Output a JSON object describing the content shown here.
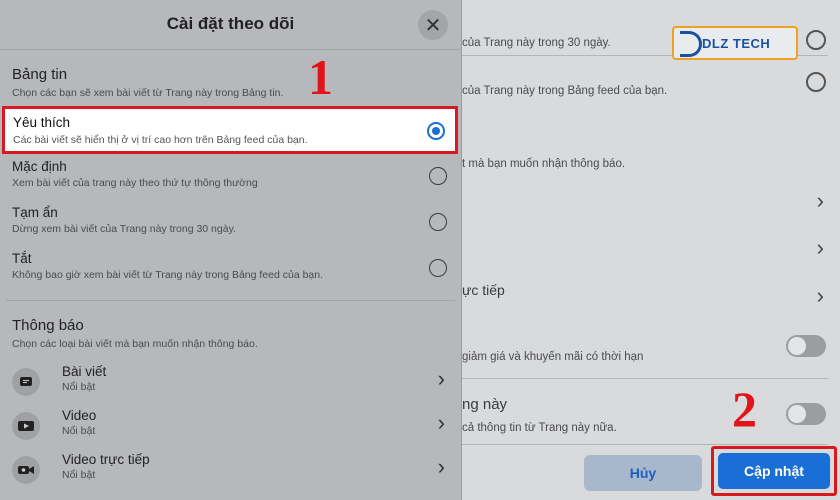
{
  "background": {
    "rows": [
      {
        "text": "của Trang này trong 30 ngày."
      },
      {
        "text": "của Trang này trong Bảng feed của bạn."
      },
      {
        "text": "t mà bạn muốn nhận thông báo."
      },
      {
        "text": "ực tiếp"
      },
      {
        "text": "giảm giá và khuyến mãi có thời hạn"
      },
      {
        "text": "ng này"
      },
      {
        "text": "cả thông tin từ Trang này nữa."
      }
    ],
    "logo_text": "DLZ TECH",
    "cancel_label": "Hủy",
    "update_label": "Cập nhật"
  },
  "dialog": {
    "title": "Cài đặt theo dõi",
    "close_glyph": "✕",
    "feed": {
      "title": "Bảng tin",
      "subtitle": "Chọn các bạn sẽ xem bài viết từ Trang này trong Bảng tin.",
      "options": [
        {
          "label": "Yêu thích",
          "desc": "Các bài viết sẽ hiển thị ở vị trí cao hơn trên Bảng feed của bạn.",
          "selected": true
        },
        {
          "label": "Mặc định",
          "desc": "Xem bài viết của trang này theo thứ tự thông thường",
          "selected": false
        },
        {
          "label": "Tạm ẩn",
          "desc": "Dừng xem bài viết của Trang này trong 30 ngày.",
          "selected": false
        },
        {
          "label": "Tắt",
          "desc": "Không bao giờ xem bài viết từ Trang này trong Bảng feed của bạn.",
          "selected": false
        }
      ]
    },
    "notifications": {
      "title": "Thông báo",
      "subtitle": "Chọn các loại bài viết mà bạn muốn nhận thông báo.",
      "items": [
        {
          "label": "Bài viết",
          "sub": "Nổi bật",
          "icon": "post-icon"
        },
        {
          "label": "Video",
          "sub": "Nổi bật",
          "icon": "video-icon"
        },
        {
          "label": "Video trực tiếp",
          "sub": "Nổi bật",
          "icon": "live-video-icon"
        }
      ]
    }
  },
  "annotations": {
    "step1": "1",
    "step2": "2"
  },
  "colors": {
    "accent": "#1a6fd6",
    "highlight": "#d71920"
  }
}
